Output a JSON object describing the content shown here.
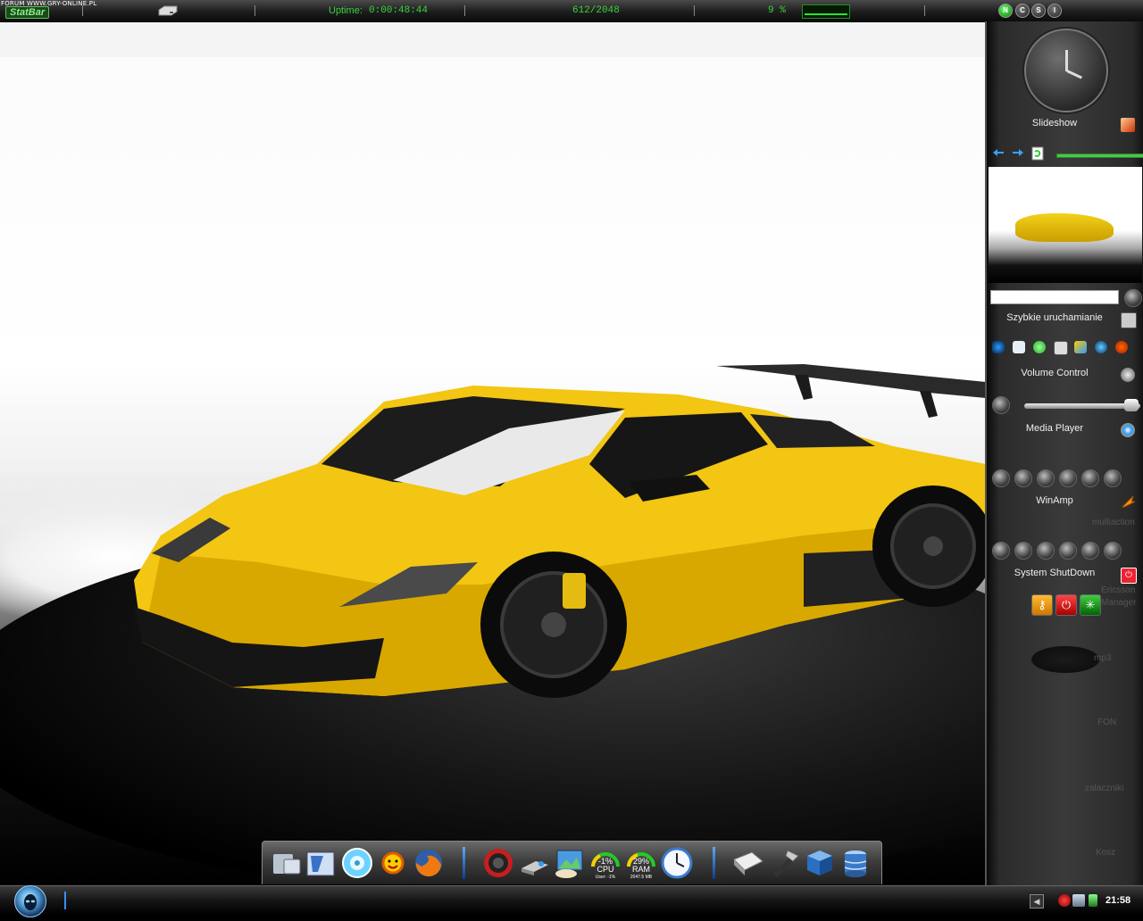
{
  "statbar": {
    "forum_text": "FORUM WWW.GRY-ONLINE.PL",
    "logo": "StatBar",
    "uptime_label": "Uptime:",
    "uptime_value": "0:00:48:44",
    "memory": "612/2048",
    "cpu_percent": "9 %",
    "buttons": [
      "N",
      "C",
      "S",
      "I"
    ]
  },
  "sidebar": {
    "slideshow_label": "Slideshow",
    "quick_launch_label": "Szybkie uruchamianie",
    "volume_label": "Volume Control",
    "volume_level": 0.9,
    "media_player_label": "Media Player",
    "winamp_label": "WinAmp",
    "shutdown_label": "System ShutDown",
    "slideshow_progress": 1.0,
    "desktop_labels": [
      "multiaction",
      "Ericsson",
      "Manager",
      "mp3",
      "FON",
      "zalaczniki",
      "Kosz"
    ]
  },
  "dock": {
    "cpu_gauge": {
      "label": "CPU",
      "value": "-1%",
      "sub": "User: -1%"
    },
    "ram_gauge": {
      "label": "RAM",
      "value": "29%",
      "sub": "2047.5 MB"
    }
  },
  "taskbar": {
    "time": "21:58"
  },
  "colors": {
    "statbar_green": "#3ad23a",
    "accent_blue": "#3a8ff0",
    "car_yellow": "#f3c80f"
  }
}
